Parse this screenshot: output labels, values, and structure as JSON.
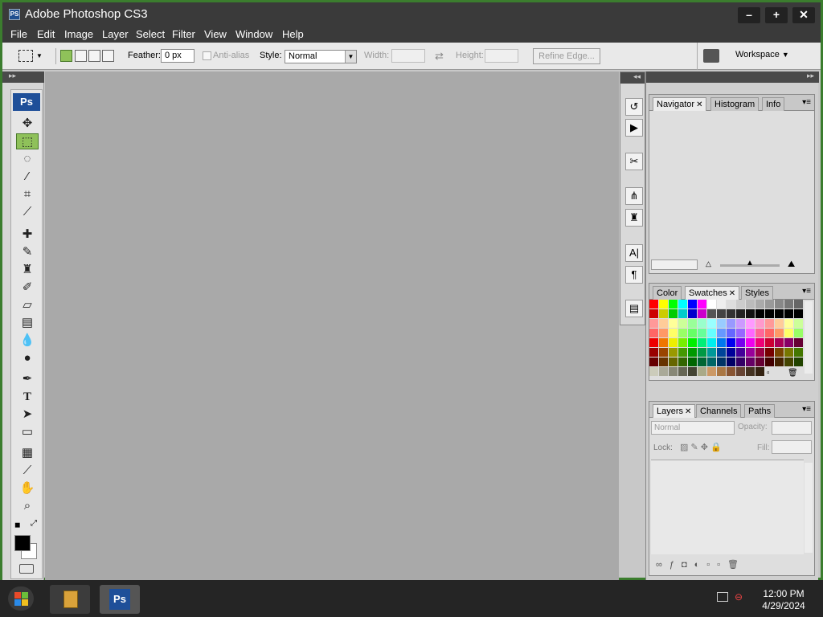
{
  "window": {
    "title": "Adobe Photoshop CS3",
    "app_icon": "PS",
    "controls": {
      "minimize": "–",
      "maximize": "+",
      "close": "✕"
    }
  },
  "menu": [
    "File",
    "Edit",
    "Image",
    "Layer",
    "Select",
    "Filter",
    "View",
    "Window",
    "Help"
  ],
  "options": {
    "feather_label": "Feather:",
    "feather_value": "0 px",
    "antialias_label": "Anti-alias",
    "style_label": "Style:",
    "style_value": "Normal",
    "width_label": "Width:",
    "height_label": "Height:",
    "refine_edge": "Refine Edge...",
    "workspace": "Workspace"
  },
  "toolbox": {
    "logo": "Ps",
    "tools": [
      "move-tool",
      "marquee-tool",
      "lasso-tool",
      "magic-wand-tool",
      "crop-tool",
      "slice-tool",
      "healing-brush-tool",
      "brush-tool",
      "clone-stamp-tool",
      "history-brush-tool",
      "eraser-tool",
      "gradient-tool",
      "blur-tool",
      "dodge-tool",
      "pen-tool",
      "type-tool",
      "path-selection-tool",
      "shape-tool",
      "notes-tool",
      "eyedropper-tool",
      "hand-tool",
      "zoom-tool"
    ],
    "type_glyph": "T"
  },
  "icon_strip": {
    "character_glyph": "A|",
    "paragraph_glyph": "¶"
  },
  "panels": {
    "navigator": {
      "tabs": [
        "Navigator",
        "Histogram",
        "Info"
      ],
      "active": "Navigator"
    },
    "swatches": {
      "tabs": [
        "Color",
        "Swatches",
        "Styles"
      ],
      "active": "Swatches"
    },
    "layers": {
      "tabs": [
        "Layers",
        "Channels",
        "Paths"
      ],
      "active": "Layers",
      "blend_mode": "Normal",
      "opacity_label": "Opacity:",
      "lock_label": "Lock:",
      "fill_label": "Fill:"
    }
  },
  "taskbar": {
    "time": "12:00 PM",
    "date": "4/29/2024",
    "ps_icon": "Ps"
  },
  "colors": {
    "titlebar": "#3a3a3a",
    "canvas": "#a9a9a9",
    "desktop": "#2d6a2f",
    "foreground": "#000000",
    "background": "#ffffff"
  }
}
